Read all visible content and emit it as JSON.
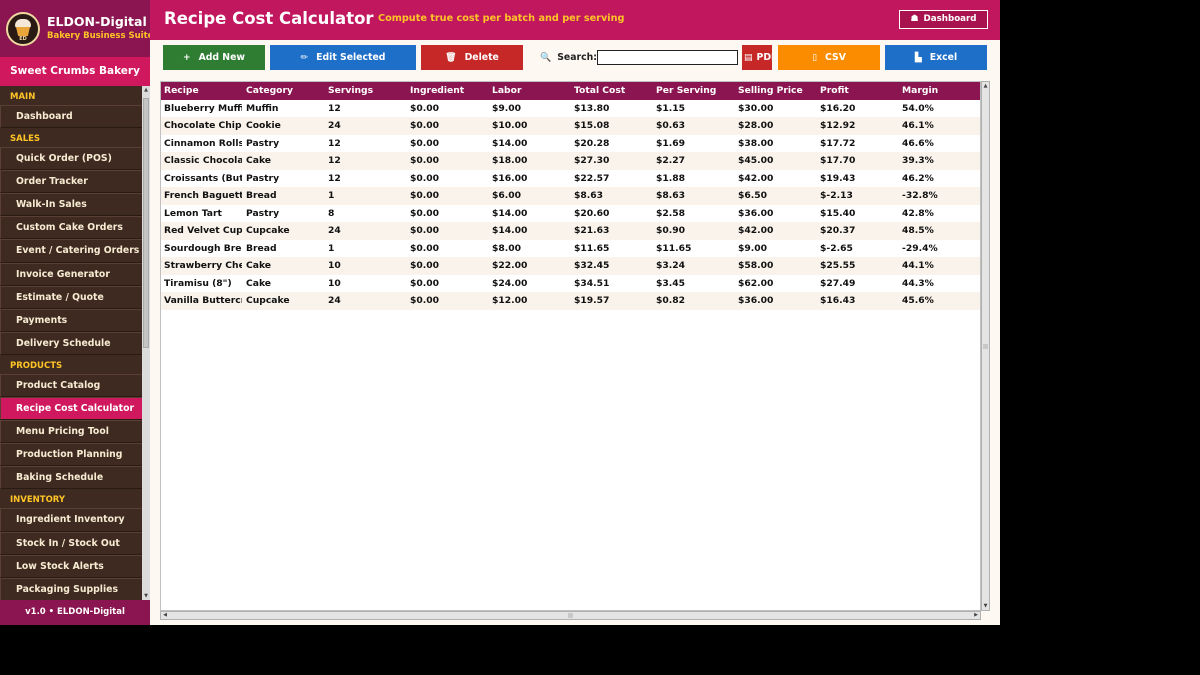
{
  "brand": {
    "title": "ELDON-Digital",
    "subtitle": "Bakery Business Suite",
    "logo_initials": "ED",
    "bakery_name": "Sweet Crumbs Bakery",
    "version": "v1.0  •  ELDON-Digital"
  },
  "sidebar": {
    "sections": [
      {
        "label": "MAIN",
        "items": [
          {
            "label": "Dashboard",
            "active": false
          }
        ]
      },
      {
        "label": "SALES",
        "items": [
          {
            "label": "Quick Order (POS)",
            "active": false
          },
          {
            "label": "Order Tracker",
            "active": false
          },
          {
            "label": "Walk-In Sales",
            "active": false
          },
          {
            "label": "Custom Cake Orders",
            "active": false
          },
          {
            "label": "Event / Catering Orders",
            "active": false
          },
          {
            "label": "Invoice Generator",
            "active": false
          },
          {
            "label": "Estimate / Quote",
            "active": false
          },
          {
            "label": "Payments",
            "active": false
          },
          {
            "label": "Delivery Schedule",
            "active": false
          }
        ]
      },
      {
        "label": "PRODUCTS",
        "items": [
          {
            "label": "Product Catalog",
            "active": false
          },
          {
            "label": "Recipe Cost Calculator",
            "active": true
          },
          {
            "label": "Menu Pricing Tool",
            "active": false
          },
          {
            "label": "Production Planning",
            "active": false
          },
          {
            "label": "Baking Schedule",
            "active": false
          }
        ]
      },
      {
        "label": "INVENTORY",
        "items": [
          {
            "label": "Ingredient Inventory",
            "active": false
          },
          {
            "label": "Stock In / Stock Out",
            "active": false
          },
          {
            "label": "Low Stock Alerts",
            "active": false
          },
          {
            "label": "Packaging Supplies",
            "active": false
          }
        ]
      }
    ]
  },
  "header": {
    "title": "Recipe Cost Calculator",
    "subtitle": "Compute true cost per batch and per serving",
    "dashboard_label": "Dashboard"
  },
  "toolbar": {
    "add_label": "Add New",
    "edit_label": "Edit Selected",
    "delete_label": "Delete",
    "search_label": "Search:",
    "search_value": "",
    "pdf_label": "PDF",
    "csv_label": "CSV",
    "excel_label": "Excel"
  },
  "colors": {
    "sidebar_bg": "#3f2a22",
    "brand_bg": "#8a1550",
    "accent": "#d0185f",
    "header_bg": "#c1175f",
    "highlight_text": "#ffc526",
    "add_btn": "#2e7d32",
    "edit_btn": "#1e6fc8",
    "delete_btn": "#c62828",
    "pdf_btn": "#c62828",
    "csv_btn": "#fb8c00",
    "excel_btn": "#1e6fc8",
    "table_header": "#8a1550"
  },
  "table": {
    "columns": [
      "Recipe",
      "Category",
      "Servings",
      "Ingredient",
      "Labor",
      "Total Cost",
      "Per Serving",
      "Selling Price",
      "Profit",
      "Margin"
    ],
    "rows": [
      [
        "Blueberry Muffins",
        "Muffin",
        "12",
        "$0.00",
        "$9.00",
        "$13.80",
        "$1.15",
        "$30.00",
        "$16.20",
        "54.0%"
      ],
      [
        "Chocolate Chip Cookies",
        "Cookie",
        "24",
        "$0.00",
        "$10.00",
        "$15.08",
        "$0.63",
        "$28.00",
        "$12.92",
        "46.1%"
      ],
      [
        "Cinnamon Rolls",
        "Pastry",
        "12",
        "$0.00",
        "$14.00",
        "$20.28",
        "$1.69",
        "$38.00",
        "$17.72",
        "46.6%"
      ],
      [
        "Classic Chocolate Cake",
        "Cake",
        "12",
        "$0.00",
        "$18.00",
        "$27.30",
        "$2.27",
        "$45.00",
        "$17.70",
        "39.3%"
      ],
      [
        "Croissants (Butter)",
        "Pastry",
        "12",
        "$0.00",
        "$16.00",
        "$22.57",
        "$1.88",
        "$42.00",
        "$19.43",
        "46.2%"
      ],
      [
        "French Baguette",
        "Bread",
        "1",
        "$0.00",
        "$6.00",
        "$8.63",
        "$8.63",
        "$6.50",
        "$-2.13",
        "-32.8%"
      ],
      [
        "Lemon Tart",
        "Pastry",
        "8",
        "$0.00",
        "$14.00",
        "$20.60",
        "$2.58",
        "$36.00",
        "$15.40",
        "42.8%"
      ],
      [
        "Red Velvet Cupcakes",
        "Cupcake",
        "24",
        "$0.00",
        "$14.00",
        "$21.63",
        "$0.90",
        "$42.00",
        "$20.37",
        "48.5%"
      ],
      [
        "Sourdough Bread",
        "Bread",
        "1",
        "$0.00",
        "$8.00",
        "$11.65",
        "$11.65",
        "$9.00",
        "$-2.65",
        "-29.4%"
      ],
      [
        "Strawberry Cheesecake",
        "Cake",
        "10",
        "$0.00",
        "$22.00",
        "$32.45",
        "$3.24",
        "$58.00",
        "$25.55",
        "44.1%"
      ],
      [
        "Tiramisu (8\")",
        "Cake",
        "10",
        "$0.00",
        "$24.00",
        "$34.51",
        "$3.45",
        "$62.00",
        "$27.49",
        "44.3%"
      ],
      [
        "Vanilla Buttercream Cupcakes",
        "Cupcake",
        "24",
        "$0.00",
        "$12.00",
        "$19.57",
        "$0.82",
        "$36.00",
        "$16.43",
        "45.6%"
      ]
    ]
  }
}
